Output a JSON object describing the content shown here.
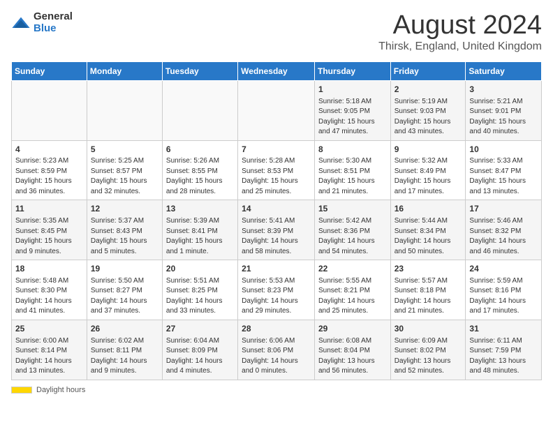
{
  "header": {
    "logo_general": "General",
    "logo_blue": "Blue",
    "month_year": "August 2024",
    "location": "Thirsk, England, United Kingdom"
  },
  "footer": {
    "daylight_label": "Daylight hours"
  },
  "weekdays": [
    "Sunday",
    "Monday",
    "Tuesday",
    "Wednesday",
    "Thursday",
    "Friday",
    "Saturday"
  ],
  "weeks": [
    [
      {
        "day": "",
        "info": ""
      },
      {
        "day": "",
        "info": ""
      },
      {
        "day": "",
        "info": ""
      },
      {
        "day": "",
        "info": ""
      },
      {
        "day": "1",
        "info": "Sunrise: 5:18 AM\nSunset: 9:05 PM\nDaylight: 15 hours\nand 47 minutes."
      },
      {
        "day": "2",
        "info": "Sunrise: 5:19 AM\nSunset: 9:03 PM\nDaylight: 15 hours\nand 43 minutes."
      },
      {
        "day": "3",
        "info": "Sunrise: 5:21 AM\nSunset: 9:01 PM\nDaylight: 15 hours\nand 40 minutes."
      }
    ],
    [
      {
        "day": "4",
        "info": "Sunrise: 5:23 AM\nSunset: 8:59 PM\nDaylight: 15 hours\nand 36 minutes."
      },
      {
        "day": "5",
        "info": "Sunrise: 5:25 AM\nSunset: 8:57 PM\nDaylight: 15 hours\nand 32 minutes."
      },
      {
        "day": "6",
        "info": "Sunrise: 5:26 AM\nSunset: 8:55 PM\nDaylight: 15 hours\nand 28 minutes."
      },
      {
        "day": "7",
        "info": "Sunrise: 5:28 AM\nSunset: 8:53 PM\nDaylight: 15 hours\nand 25 minutes."
      },
      {
        "day": "8",
        "info": "Sunrise: 5:30 AM\nSunset: 8:51 PM\nDaylight: 15 hours\nand 21 minutes."
      },
      {
        "day": "9",
        "info": "Sunrise: 5:32 AM\nSunset: 8:49 PM\nDaylight: 15 hours\nand 17 minutes."
      },
      {
        "day": "10",
        "info": "Sunrise: 5:33 AM\nSunset: 8:47 PM\nDaylight: 15 hours\nand 13 minutes."
      }
    ],
    [
      {
        "day": "11",
        "info": "Sunrise: 5:35 AM\nSunset: 8:45 PM\nDaylight: 15 hours\nand 9 minutes."
      },
      {
        "day": "12",
        "info": "Sunrise: 5:37 AM\nSunset: 8:43 PM\nDaylight: 15 hours\nand 5 minutes."
      },
      {
        "day": "13",
        "info": "Sunrise: 5:39 AM\nSunset: 8:41 PM\nDaylight: 15 hours\nand 1 minute."
      },
      {
        "day": "14",
        "info": "Sunrise: 5:41 AM\nSunset: 8:39 PM\nDaylight: 14 hours\nand 58 minutes."
      },
      {
        "day": "15",
        "info": "Sunrise: 5:42 AM\nSunset: 8:36 PM\nDaylight: 14 hours\nand 54 minutes."
      },
      {
        "day": "16",
        "info": "Sunrise: 5:44 AM\nSunset: 8:34 PM\nDaylight: 14 hours\nand 50 minutes."
      },
      {
        "day": "17",
        "info": "Sunrise: 5:46 AM\nSunset: 8:32 PM\nDaylight: 14 hours\nand 46 minutes."
      }
    ],
    [
      {
        "day": "18",
        "info": "Sunrise: 5:48 AM\nSunset: 8:30 PM\nDaylight: 14 hours\nand 41 minutes."
      },
      {
        "day": "19",
        "info": "Sunrise: 5:50 AM\nSunset: 8:27 PM\nDaylight: 14 hours\nand 37 minutes."
      },
      {
        "day": "20",
        "info": "Sunrise: 5:51 AM\nSunset: 8:25 PM\nDaylight: 14 hours\nand 33 minutes."
      },
      {
        "day": "21",
        "info": "Sunrise: 5:53 AM\nSunset: 8:23 PM\nDaylight: 14 hours\nand 29 minutes."
      },
      {
        "day": "22",
        "info": "Sunrise: 5:55 AM\nSunset: 8:21 PM\nDaylight: 14 hours\nand 25 minutes."
      },
      {
        "day": "23",
        "info": "Sunrise: 5:57 AM\nSunset: 8:18 PM\nDaylight: 14 hours\nand 21 minutes."
      },
      {
        "day": "24",
        "info": "Sunrise: 5:59 AM\nSunset: 8:16 PM\nDaylight: 14 hours\nand 17 minutes."
      }
    ],
    [
      {
        "day": "25",
        "info": "Sunrise: 6:00 AM\nSunset: 8:14 PM\nDaylight: 14 hours\nand 13 minutes."
      },
      {
        "day": "26",
        "info": "Sunrise: 6:02 AM\nSunset: 8:11 PM\nDaylight: 14 hours\nand 9 minutes."
      },
      {
        "day": "27",
        "info": "Sunrise: 6:04 AM\nSunset: 8:09 PM\nDaylight: 14 hours\nand 4 minutes."
      },
      {
        "day": "28",
        "info": "Sunrise: 6:06 AM\nSunset: 8:06 PM\nDaylight: 14 hours\nand 0 minutes."
      },
      {
        "day": "29",
        "info": "Sunrise: 6:08 AM\nSunset: 8:04 PM\nDaylight: 13 hours\nand 56 minutes."
      },
      {
        "day": "30",
        "info": "Sunrise: 6:09 AM\nSunset: 8:02 PM\nDaylight: 13 hours\nand 52 minutes."
      },
      {
        "day": "31",
        "info": "Sunrise: 6:11 AM\nSunset: 7:59 PM\nDaylight: 13 hours\nand 48 minutes."
      }
    ]
  ]
}
